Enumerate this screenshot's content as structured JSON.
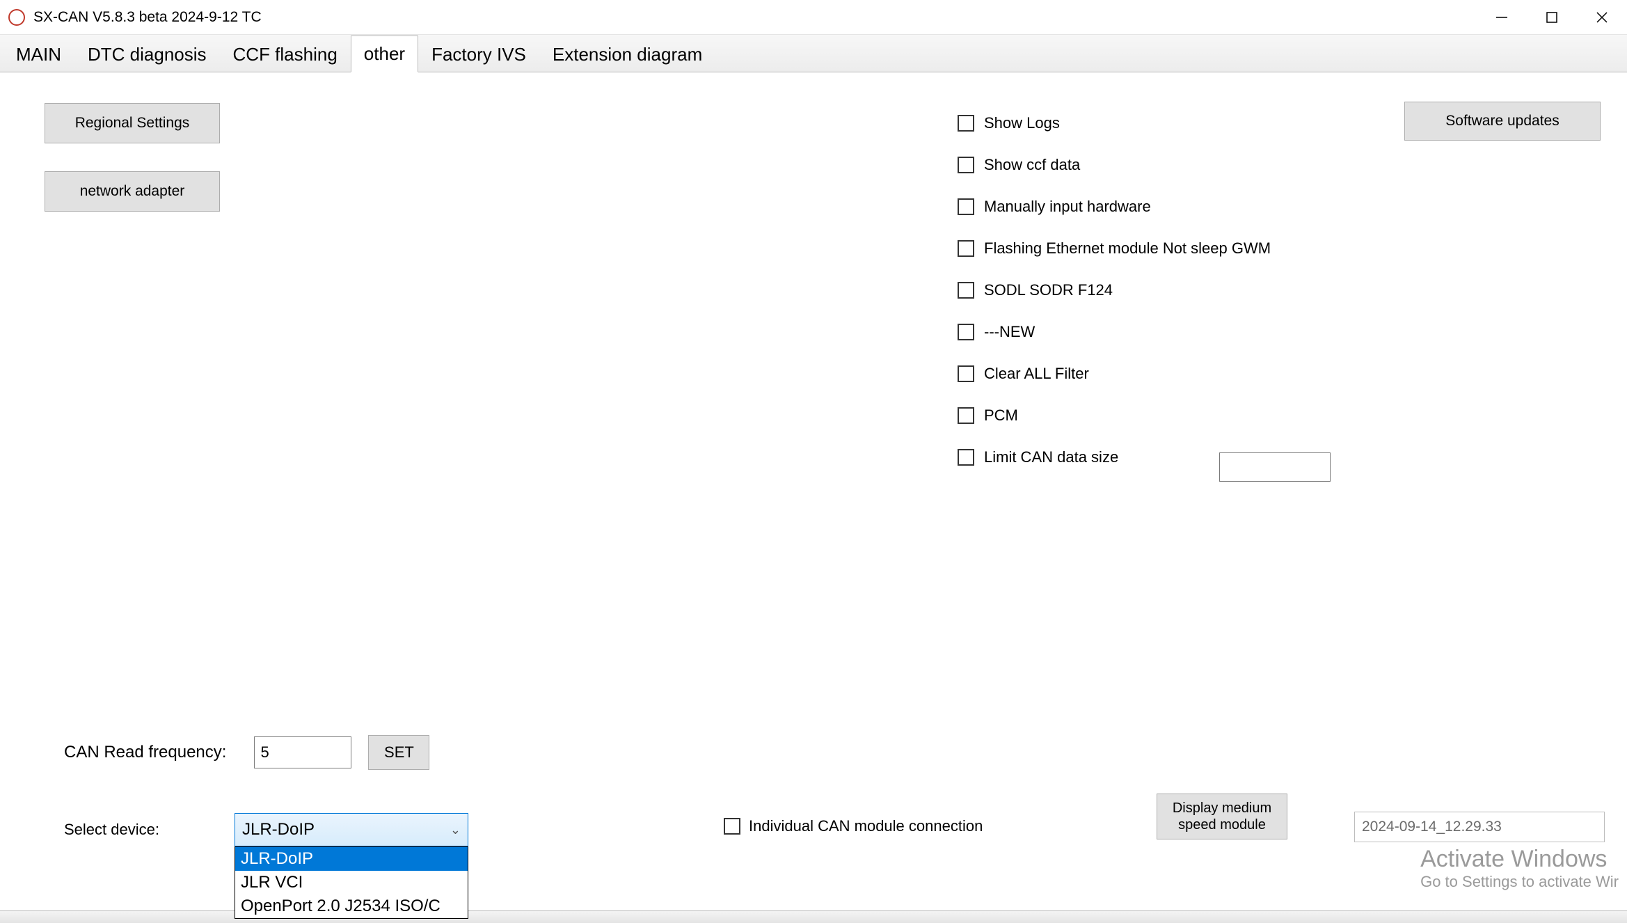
{
  "window": {
    "title": "SX-CAN V5.8.3 beta 2024-9-12 TC"
  },
  "tabs": {
    "main": "MAIN",
    "dtc": "DTC diagnosis",
    "ccf": "CCF flashing",
    "other": "other",
    "factory": "Factory IVS",
    "ext": "Extension diagram"
  },
  "buttons": {
    "regional": "Regional Settings",
    "network": "network adapter",
    "updates": "Software updates",
    "set": "SET",
    "medium": "Display medium speed module"
  },
  "checkboxes": {
    "show_logs": "Show Logs",
    "show_ccf": "Show ccf data",
    "manual_hw": "Manually input hardware",
    "flash_eth": "Flashing Ethernet module Not sleep GWM",
    "sodl": "SODL SODR F124",
    "new": "---NEW",
    "clear_filter": "Clear ALL Filter",
    "pcm": "PCM",
    "limit_can": "Limit CAN data size",
    "indiv_can": "Individual CAN module connection"
  },
  "labels": {
    "freq": "CAN Read frequency:",
    "device": "Select device:"
  },
  "values": {
    "freq": "5",
    "limit_can": "",
    "timestamp": "2024-09-14_12.29.33"
  },
  "device_select": {
    "selected": "JLR-DoIP",
    "options": {
      "o0": "JLR-DoIP",
      "o1": "JLR VCI",
      "o2": "OpenPort 2.0 J2534 ISO/C"
    }
  },
  "watermark": {
    "line1": "Activate Windows",
    "line2": "Go to Settings to activate Wir"
  }
}
